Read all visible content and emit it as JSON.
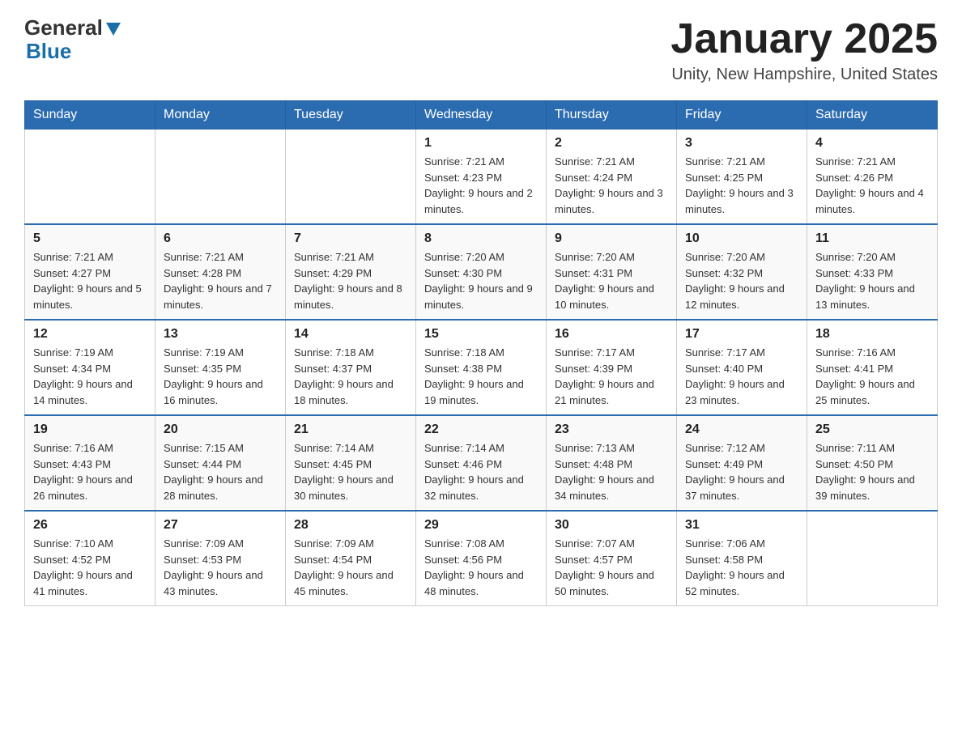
{
  "logo": {
    "general": "General",
    "blue": "Blue"
  },
  "title": "January 2025",
  "subtitle": "Unity, New Hampshire, United States",
  "days": [
    "Sunday",
    "Monday",
    "Tuesday",
    "Wednesday",
    "Thursday",
    "Friday",
    "Saturday"
  ],
  "weeks": [
    [
      {
        "day": "",
        "info": ""
      },
      {
        "day": "",
        "info": ""
      },
      {
        "day": "",
        "info": ""
      },
      {
        "day": "1",
        "info": "Sunrise: 7:21 AM\nSunset: 4:23 PM\nDaylight: 9 hours and 2 minutes."
      },
      {
        "day": "2",
        "info": "Sunrise: 7:21 AM\nSunset: 4:24 PM\nDaylight: 9 hours and 3 minutes."
      },
      {
        "day": "3",
        "info": "Sunrise: 7:21 AM\nSunset: 4:25 PM\nDaylight: 9 hours and 3 minutes."
      },
      {
        "day": "4",
        "info": "Sunrise: 7:21 AM\nSunset: 4:26 PM\nDaylight: 9 hours and 4 minutes."
      }
    ],
    [
      {
        "day": "5",
        "info": "Sunrise: 7:21 AM\nSunset: 4:27 PM\nDaylight: 9 hours and 5 minutes."
      },
      {
        "day": "6",
        "info": "Sunrise: 7:21 AM\nSunset: 4:28 PM\nDaylight: 9 hours and 7 minutes."
      },
      {
        "day": "7",
        "info": "Sunrise: 7:21 AM\nSunset: 4:29 PM\nDaylight: 9 hours and 8 minutes."
      },
      {
        "day": "8",
        "info": "Sunrise: 7:20 AM\nSunset: 4:30 PM\nDaylight: 9 hours and 9 minutes."
      },
      {
        "day": "9",
        "info": "Sunrise: 7:20 AM\nSunset: 4:31 PM\nDaylight: 9 hours and 10 minutes."
      },
      {
        "day": "10",
        "info": "Sunrise: 7:20 AM\nSunset: 4:32 PM\nDaylight: 9 hours and 12 minutes."
      },
      {
        "day": "11",
        "info": "Sunrise: 7:20 AM\nSunset: 4:33 PM\nDaylight: 9 hours and 13 minutes."
      }
    ],
    [
      {
        "day": "12",
        "info": "Sunrise: 7:19 AM\nSunset: 4:34 PM\nDaylight: 9 hours and 14 minutes."
      },
      {
        "day": "13",
        "info": "Sunrise: 7:19 AM\nSunset: 4:35 PM\nDaylight: 9 hours and 16 minutes."
      },
      {
        "day": "14",
        "info": "Sunrise: 7:18 AM\nSunset: 4:37 PM\nDaylight: 9 hours and 18 minutes."
      },
      {
        "day": "15",
        "info": "Sunrise: 7:18 AM\nSunset: 4:38 PM\nDaylight: 9 hours and 19 minutes."
      },
      {
        "day": "16",
        "info": "Sunrise: 7:17 AM\nSunset: 4:39 PM\nDaylight: 9 hours and 21 minutes."
      },
      {
        "day": "17",
        "info": "Sunrise: 7:17 AM\nSunset: 4:40 PM\nDaylight: 9 hours and 23 minutes."
      },
      {
        "day": "18",
        "info": "Sunrise: 7:16 AM\nSunset: 4:41 PM\nDaylight: 9 hours and 25 minutes."
      }
    ],
    [
      {
        "day": "19",
        "info": "Sunrise: 7:16 AM\nSunset: 4:43 PM\nDaylight: 9 hours and 26 minutes."
      },
      {
        "day": "20",
        "info": "Sunrise: 7:15 AM\nSunset: 4:44 PM\nDaylight: 9 hours and 28 minutes."
      },
      {
        "day": "21",
        "info": "Sunrise: 7:14 AM\nSunset: 4:45 PM\nDaylight: 9 hours and 30 minutes."
      },
      {
        "day": "22",
        "info": "Sunrise: 7:14 AM\nSunset: 4:46 PM\nDaylight: 9 hours and 32 minutes."
      },
      {
        "day": "23",
        "info": "Sunrise: 7:13 AM\nSunset: 4:48 PM\nDaylight: 9 hours and 34 minutes."
      },
      {
        "day": "24",
        "info": "Sunrise: 7:12 AM\nSunset: 4:49 PM\nDaylight: 9 hours and 37 minutes."
      },
      {
        "day": "25",
        "info": "Sunrise: 7:11 AM\nSunset: 4:50 PM\nDaylight: 9 hours and 39 minutes."
      }
    ],
    [
      {
        "day": "26",
        "info": "Sunrise: 7:10 AM\nSunset: 4:52 PM\nDaylight: 9 hours and 41 minutes."
      },
      {
        "day": "27",
        "info": "Sunrise: 7:09 AM\nSunset: 4:53 PM\nDaylight: 9 hours and 43 minutes."
      },
      {
        "day": "28",
        "info": "Sunrise: 7:09 AM\nSunset: 4:54 PM\nDaylight: 9 hours and 45 minutes."
      },
      {
        "day": "29",
        "info": "Sunrise: 7:08 AM\nSunset: 4:56 PM\nDaylight: 9 hours and 48 minutes."
      },
      {
        "day": "30",
        "info": "Sunrise: 7:07 AM\nSunset: 4:57 PM\nDaylight: 9 hours and 50 minutes."
      },
      {
        "day": "31",
        "info": "Sunrise: 7:06 AM\nSunset: 4:58 PM\nDaylight: 9 hours and 52 minutes."
      },
      {
        "day": "",
        "info": ""
      }
    ]
  ]
}
